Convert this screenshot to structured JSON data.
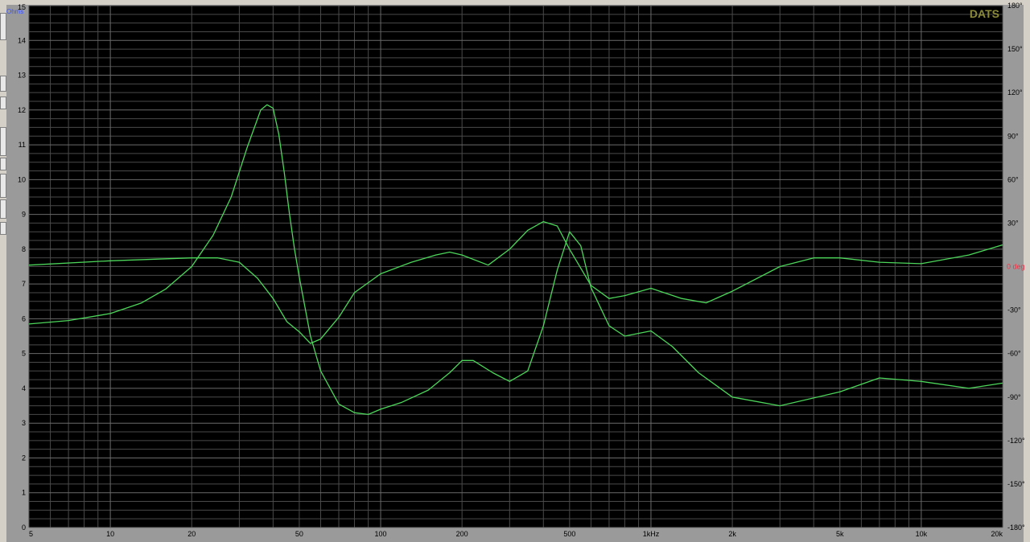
{
  "chart_data": {
    "type": "line",
    "watermark": "DATS",
    "left_axis_label": "Ohms",
    "right_axis_label": "0 deg",
    "x_scale": "log",
    "xlim": [
      5,
      20000
    ],
    "y_left_lim": [
      0,
      15
    ],
    "y_right_lim": [
      -180,
      180
    ],
    "grid": true,
    "x_tick_values": [
      5,
      10,
      20,
      50,
      100,
      200,
      500,
      1000,
      2000,
      5000,
      10000,
      20000
    ],
    "x_tick_labels": [
      "5",
      "10",
      "20",
      "50",
      "100",
      "200",
      "500",
      "1kHz",
      "2k",
      "5k",
      "10k",
      "20k"
    ],
    "y_left_ticks": [
      0,
      1,
      2,
      3,
      4,
      5,
      6,
      7,
      8,
      9,
      10,
      11,
      12,
      13,
      14,
      15
    ],
    "y_right_ticks": [
      "180°",
      "150°",
      "120°",
      "90°",
      "60°",
      "30°",
      "-30°",
      "-60°",
      "-90°",
      "-120°",
      "-150°",
      "-180°"
    ],
    "colors": {
      "background": "#000000",
      "trace": "#4cd65a",
      "watermark": "#8a8a3a",
      "ohms": "#3a52ff",
      "deg": "#e0384a",
      "grid": "#4a4a4a"
    },
    "series": [
      {
        "axis": "left",
        "x": [
          5,
          7,
          10,
          13,
          16,
          20,
          24,
          28,
          32,
          36,
          38,
          40,
          42,
          44,
          46,
          48,
          50,
          55,
          60,
          70,
          80,
          90,
          100,
          120,
          150,
          180,
          200,
          220,
          260,
          300,
          350,
          400,
          450,
          500,
          550,
          600,
          700,
          800,
          1000,
          1200,
          1500,
          2000,
          3000,
          5000,
          7000,
          10000,
          15000,
          20000
        ],
        "y": [
          5.85,
          5.95,
          6.15,
          6.45,
          6.85,
          7.5,
          8.4,
          9.5,
          10.9,
          12.0,
          12.15,
          12.05,
          11.3,
          10.2,
          9.0,
          8.0,
          7.2,
          5.5,
          4.5,
          3.55,
          3.3,
          3.25,
          3.4,
          3.6,
          3.95,
          4.45,
          4.8,
          4.8,
          4.45,
          4.2,
          4.5,
          5.8,
          7.4,
          8.5,
          8.1,
          6.9,
          5.8,
          5.5,
          5.65,
          5.2,
          4.45,
          3.75,
          3.5,
          3.9,
          4.3,
          4.2,
          4.0,
          4.15
        ]
      },
      {
        "axis": "right",
        "x": [
          5,
          10,
          20,
          25,
          30,
          35,
          40,
          45,
          50,
          55,
          60,
          70,
          80,
          100,
          130,
          160,
          180,
          200,
          250,
          300,
          350,
          400,
          450,
          500,
          600,
          700,
          800,
          1000,
          1300,
          1600,
          2000,
          3000,
          4000,
          5000,
          7000,
          10000,
          15000,
          20000
        ],
        "y": [
          1,
          4,
          6,
          6,
          3,
          -8,
          -22,
          -38,
          -45,
          -53,
          -50,
          -35,
          -18,
          -5,
          3,
          8,
          10,
          8,
          1,
          12,
          25,
          31,
          28,
          12,
          -13,
          -22,
          -20,
          -15,
          -22,
          -25,
          -17,
          0,
          6,
          6,
          3,
          2,
          8,
          15
        ]
      }
    ]
  }
}
